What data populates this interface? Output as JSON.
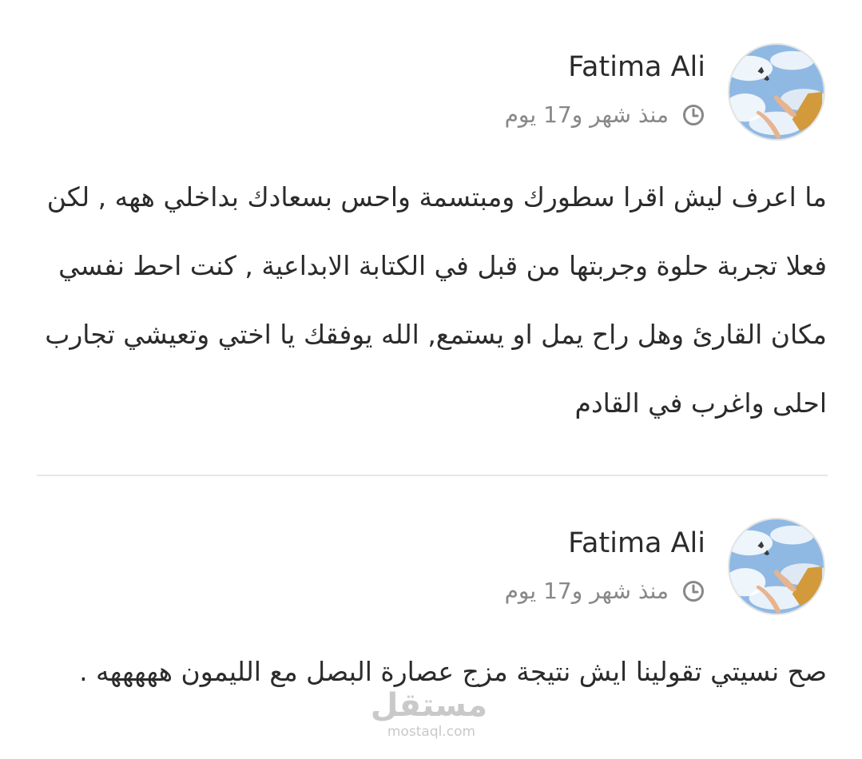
{
  "comments": [
    {
      "author": "Fatima Ali",
      "time": "منذ شهر و17 يوم",
      "text": "ما اعرف ليش اقرا سطورك ومبتسمة واحس بسعادك بداخلي ههه , لكن فعلا تجربة حلوة وجربتها من قبل في الكتابة الابداعية , كنت احط نفسي مكان القارئ وهل راح يمل او يستمع, الله يوفقك يا اختي وتعيشي تجارب احلى واغرب في القادم"
    },
    {
      "author": "Fatima Ali",
      "time": "منذ شهر و17 يوم",
      "text": "صح نسيتي تقولينا ايش نتيجة مزج عصارة البصل مع الليمون هههههه ."
    }
  ],
  "watermark": {
    "logo": "مستقل",
    "url": "mostaql.com"
  },
  "colors": {
    "text": "#2b2b2b",
    "meta": "#888888",
    "divider": "#e6e6e6",
    "watermark": "#c9c9c9"
  },
  "icons": {
    "time": "clock-icon",
    "avatar": "sky-hands-butterfly-avatar"
  }
}
